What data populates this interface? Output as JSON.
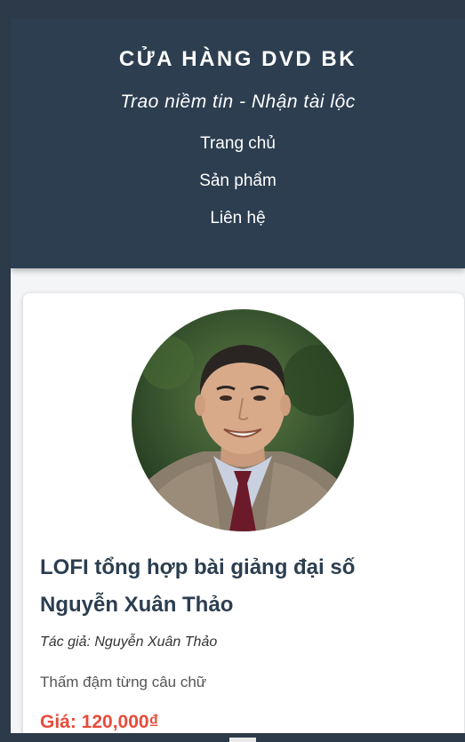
{
  "header": {
    "title": "CỬA HÀNG DVD BK",
    "tagline": "Trao niềm tin - Nhận tài lộc",
    "nav": [
      "Trang chủ",
      "Sản phẩm",
      "Liên hệ"
    ]
  },
  "product": {
    "title": "LOFI tổng hợp bài giảng đại số Nguyễn Xuân Thảo",
    "author": "Tác giả: Nguyễn Xuân Thảo",
    "description": "Thấm đậm từng câu chữ",
    "price": "Giá: 120,000₫"
  },
  "colors": {
    "header_bg": "#2c3e50",
    "price": "#e74c3c",
    "title": "#2c3e50"
  }
}
